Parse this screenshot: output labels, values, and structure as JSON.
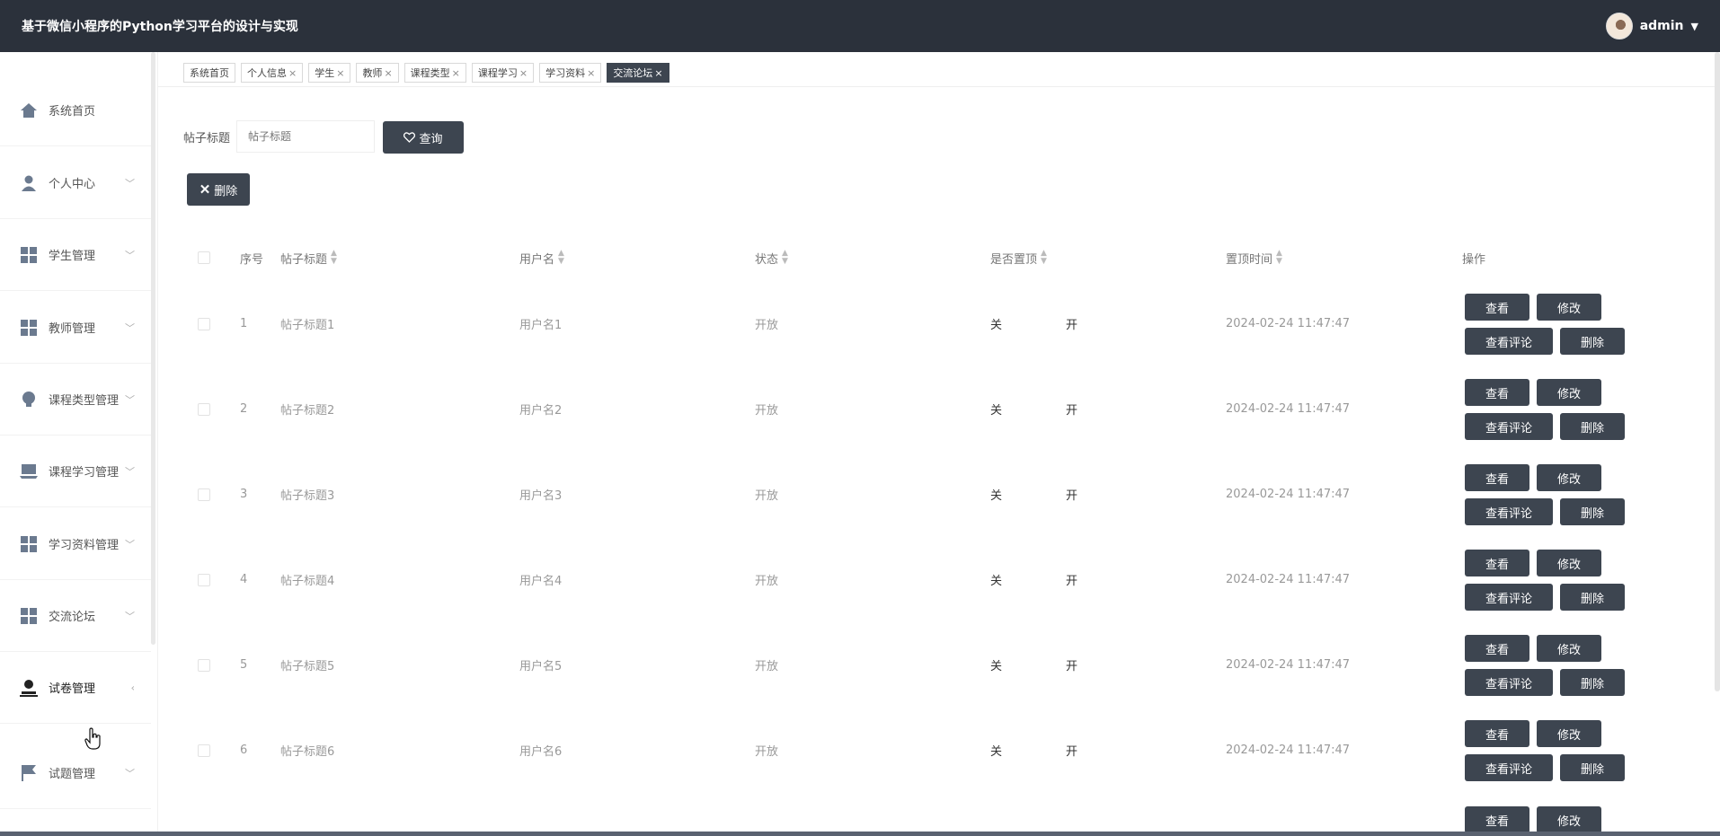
{
  "header": {
    "title": "基于微信小程序的Python学习平台的设计与实现",
    "user": "admin"
  },
  "sidebar": {
    "items": [
      {
        "label": "系统首页",
        "icon": "home-icon",
        "has_arrow": false
      },
      {
        "label": "个人中心",
        "icon": "user-icon",
        "has_arrow": true
      },
      {
        "label": "学生管理",
        "icon": "grid-icon",
        "has_arrow": true
      },
      {
        "label": "教师管理",
        "icon": "grid-icon",
        "has_arrow": true
      },
      {
        "label": "课程类型管理",
        "icon": "bulb-icon",
        "has_arrow": true
      },
      {
        "label": "课程学习管理",
        "icon": "laptop-icon",
        "has_arrow": true
      },
      {
        "label": "学习资料管理",
        "icon": "grid-icon",
        "has_arrow": true
      },
      {
        "label": "交流论坛",
        "icon": "grid-icon",
        "has_arrow": true
      },
      {
        "label": "试卷管理",
        "icon": "stamp-icon",
        "has_arrow": true
      },
      {
        "label": "试题管理",
        "icon": "flag-icon",
        "has_arrow": true
      }
    ]
  },
  "tabs": [
    {
      "label": "系统首页",
      "closable": false
    },
    {
      "label": "个人信息",
      "closable": true
    },
    {
      "label": "学生",
      "closable": true
    },
    {
      "label": "教师",
      "closable": true
    },
    {
      "label": "课程类型",
      "closable": true
    },
    {
      "label": "课程学习",
      "closable": true
    },
    {
      "label": "学习资料",
      "closable": true
    },
    {
      "label": "交流论坛",
      "closable": true,
      "active": true
    }
  ],
  "search": {
    "label": "帖子标题",
    "placeholder": "帖子标题",
    "button": "查询"
  },
  "toolbar": {
    "delete_label": "删除"
  },
  "table": {
    "columns": [
      "序号",
      "帖子标题",
      "用户名",
      "状态",
      "是否置顶",
      "置顶时间",
      "操作"
    ],
    "rows": [
      {
        "index": "1",
        "title": "帖子标题1",
        "user": "用户名1",
        "status": "开放",
        "off": "关",
        "on": "开",
        "time": "2024-02-24 11:47:47"
      },
      {
        "index": "2",
        "title": "帖子标题2",
        "user": "用户名2",
        "status": "开放",
        "off": "关",
        "on": "开",
        "time": "2024-02-24 11:47:47"
      },
      {
        "index": "3",
        "title": "帖子标题3",
        "user": "用户名3",
        "status": "开放",
        "off": "关",
        "on": "开",
        "time": "2024-02-24 11:47:47"
      },
      {
        "index": "4",
        "title": "帖子标题4",
        "user": "用户名4",
        "status": "开放",
        "off": "关",
        "on": "开",
        "time": "2024-02-24 11:47:47"
      },
      {
        "index": "5",
        "title": "帖子标题5",
        "user": "用户名5",
        "status": "开放",
        "off": "关",
        "on": "开",
        "time": "2024-02-24 11:47:47"
      },
      {
        "index": "6",
        "title": "帖子标题6",
        "user": "用户名6",
        "status": "开放",
        "off": "关",
        "on": "开",
        "time": "2024-02-24 11:47:47"
      }
    ],
    "actions": {
      "view": "查看",
      "edit": "修改",
      "comments": "查看评论",
      "delete": "删除"
    }
  },
  "colors": {
    "header_bg": "#2b313b",
    "button_bg": "#3d4550",
    "icon": "#6b7a8f"
  }
}
